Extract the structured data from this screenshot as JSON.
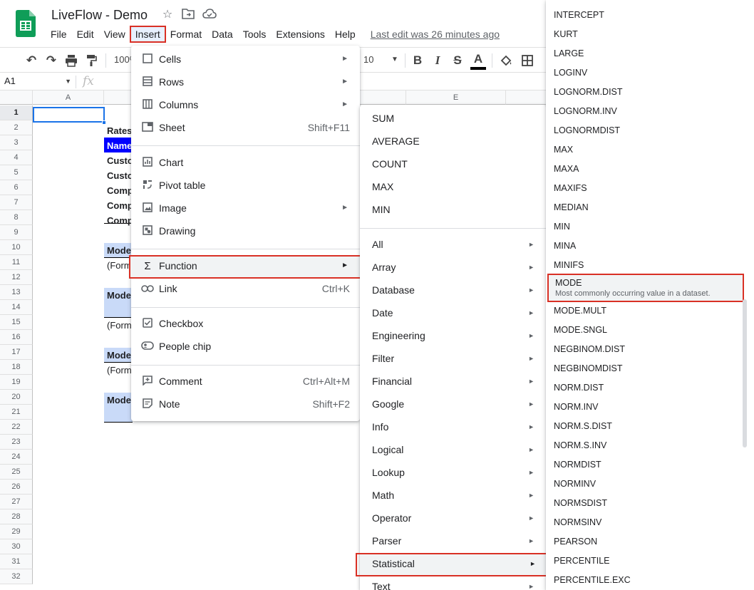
{
  "header": {
    "doc_title": "LiveFlow - Demo",
    "star_icon": "star-icon",
    "move_icon": "folder-move-icon",
    "cloud_icon": "cloud-status-icon",
    "menus": [
      "File",
      "Edit",
      "View",
      "Insert",
      "Format",
      "Data",
      "Tools",
      "Extensions",
      "Help"
    ],
    "active_menu": "Insert",
    "last_edit": "Last edit was 26 minutes ago",
    "logo_color": "#0f9d58"
  },
  "toolbar": {
    "zoom": "100%",
    "font_size": "10",
    "icons": [
      "undo-icon",
      "redo-icon",
      "print-icon",
      "paint-format-icon",
      "bold-icon",
      "italic-icon",
      "strikethrough-icon",
      "text-color-icon",
      "fill-color-icon",
      "borders-icon"
    ]
  },
  "formula_bar": {
    "name_box": "A1",
    "fx": "fx"
  },
  "grid": {
    "columns": [
      "A",
      "E"
    ],
    "rows": [
      "1",
      "2",
      "3",
      "4",
      "5",
      "6",
      "7",
      "8",
      "9",
      "10",
      "11",
      "12",
      "13",
      "14",
      "15",
      "16",
      "17",
      "18",
      "19",
      "20",
      "21",
      "22",
      "23",
      "24",
      "25",
      "26",
      "27",
      "28",
      "29",
      "30",
      "31",
      "32"
    ],
    "cells": {
      "r2": "Rates",
      "r3": "Name",
      "r4": "Custo",
      "r5": "Custo",
      "r6": "Comp",
      "r7": "Comp",
      "r8": "Comp",
      "r10": "Mode",
      "r11": "(Form",
      "r13": "Mode",
      "r15": "(Form",
      "r17": "Mode",
      "r18": "(Form",
      "r20": "Mode"
    },
    "header_blue": "#0000ff",
    "section_blue": "#c9daf8"
  },
  "insert_menu": {
    "items": [
      {
        "icon": "cells-icon",
        "label": "Cells",
        "shortcut": "",
        "submenu": true
      },
      {
        "icon": "rows-icon",
        "label": "Rows",
        "shortcut": "",
        "submenu": true
      },
      {
        "icon": "columns-icon",
        "label": "Columns",
        "shortcut": "",
        "submenu": true
      },
      {
        "icon": "sheet-icon",
        "label": "Sheet",
        "shortcut": "Shift+F11",
        "submenu": false
      },
      {
        "icon": "chart-icon",
        "label": "Chart",
        "shortcut": "",
        "submenu": false
      },
      {
        "icon": "pivot-table-icon",
        "label": "Pivot table",
        "shortcut": "",
        "submenu": false
      },
      {
        "icon": "image-icon",
        "label": "Image",
        "shortcut": "",
        "submenu": true
      },
      {
        "icon": "drawing-icon",
        "label": "Drawing",
        "shortcut": "",
        "submenu": false
      },
      {
        "icon": "sigma-icon",
        "label": "Function",
        "shortcut": "",
        "submenu": true
      },
      {
        "icon": "link-icon",
        "label": "Link",
        "shortcut": "Ctrl+K",
        "submenu": false
      },
      {
        "icon": "checkbox-icon",
        "label": "Checkbox",
        "shortcut": "",
        "submenu": false
      },
      {
        "icon": "people-chip-icon",
        "label": "People chip",
        "shortcut": "",
        "submenu": false
      },
      {
        "icon": "comment-icon",
        "label": "Comment",
        "shortcut": "Ctrl+Alt+M",
        "submenu": false
      },
      {
        "icon": "note-icon",
        "label": "Note",
        "shortcut": "Shift+F2",
        "submenu": false
      }
    ]
  },
  "function_menu": {
    "quick": [
      "SUM",
      "AVERAGE",
      "COUNT",
      "MAX",
      "MIN"
    ],
    "categories": [
      "All",
      "Array",
      "Database",
      "Date",
      "Engineering",
      "Filter",
      "Financial",
      "Google",
      "Info",
      "Logical",
      "Lookup",
      "Math",
      "Operator",
      "Parser",
      "Statistical",
      "Text"
    ],
    "selected": "Statistical"
  },
  "statistical_menu": {
    "items_before": [
      "INTERCEPT",
      "KURT",
      "LARGE",
      "LOGINV",
      "LOGNORM.DIST",
      "LOGNORM.INV",
      "LOGNORMDIST",
      "MAX",
      "MAXA",
      "MAXIFS",
      "MEDIAN",
      "MIN",
      "MINA",
      "MINIFS"
    ],
    "selected": {
      "label": "MODE",
      "description": "Most commonly occurring value in a dataset."
    },
    "items_after": [
      "MODE.MULT",
      "MODE.SNGL",
      "NEGBINOM.DIST",
      "NEGBINOMDIST",
      "NORM.DIST",
      "NORM.INV",
      "NORM.S.DIST",
      "NORM.S.INV",
      "NORMDIST",
      "NORMINV",
      "NORMSDIST",
      "NORMSINV",
      "PEARSON",
      "PERCENTILE",
      "PERCENTILE.EXC"
    ]
  }
}
